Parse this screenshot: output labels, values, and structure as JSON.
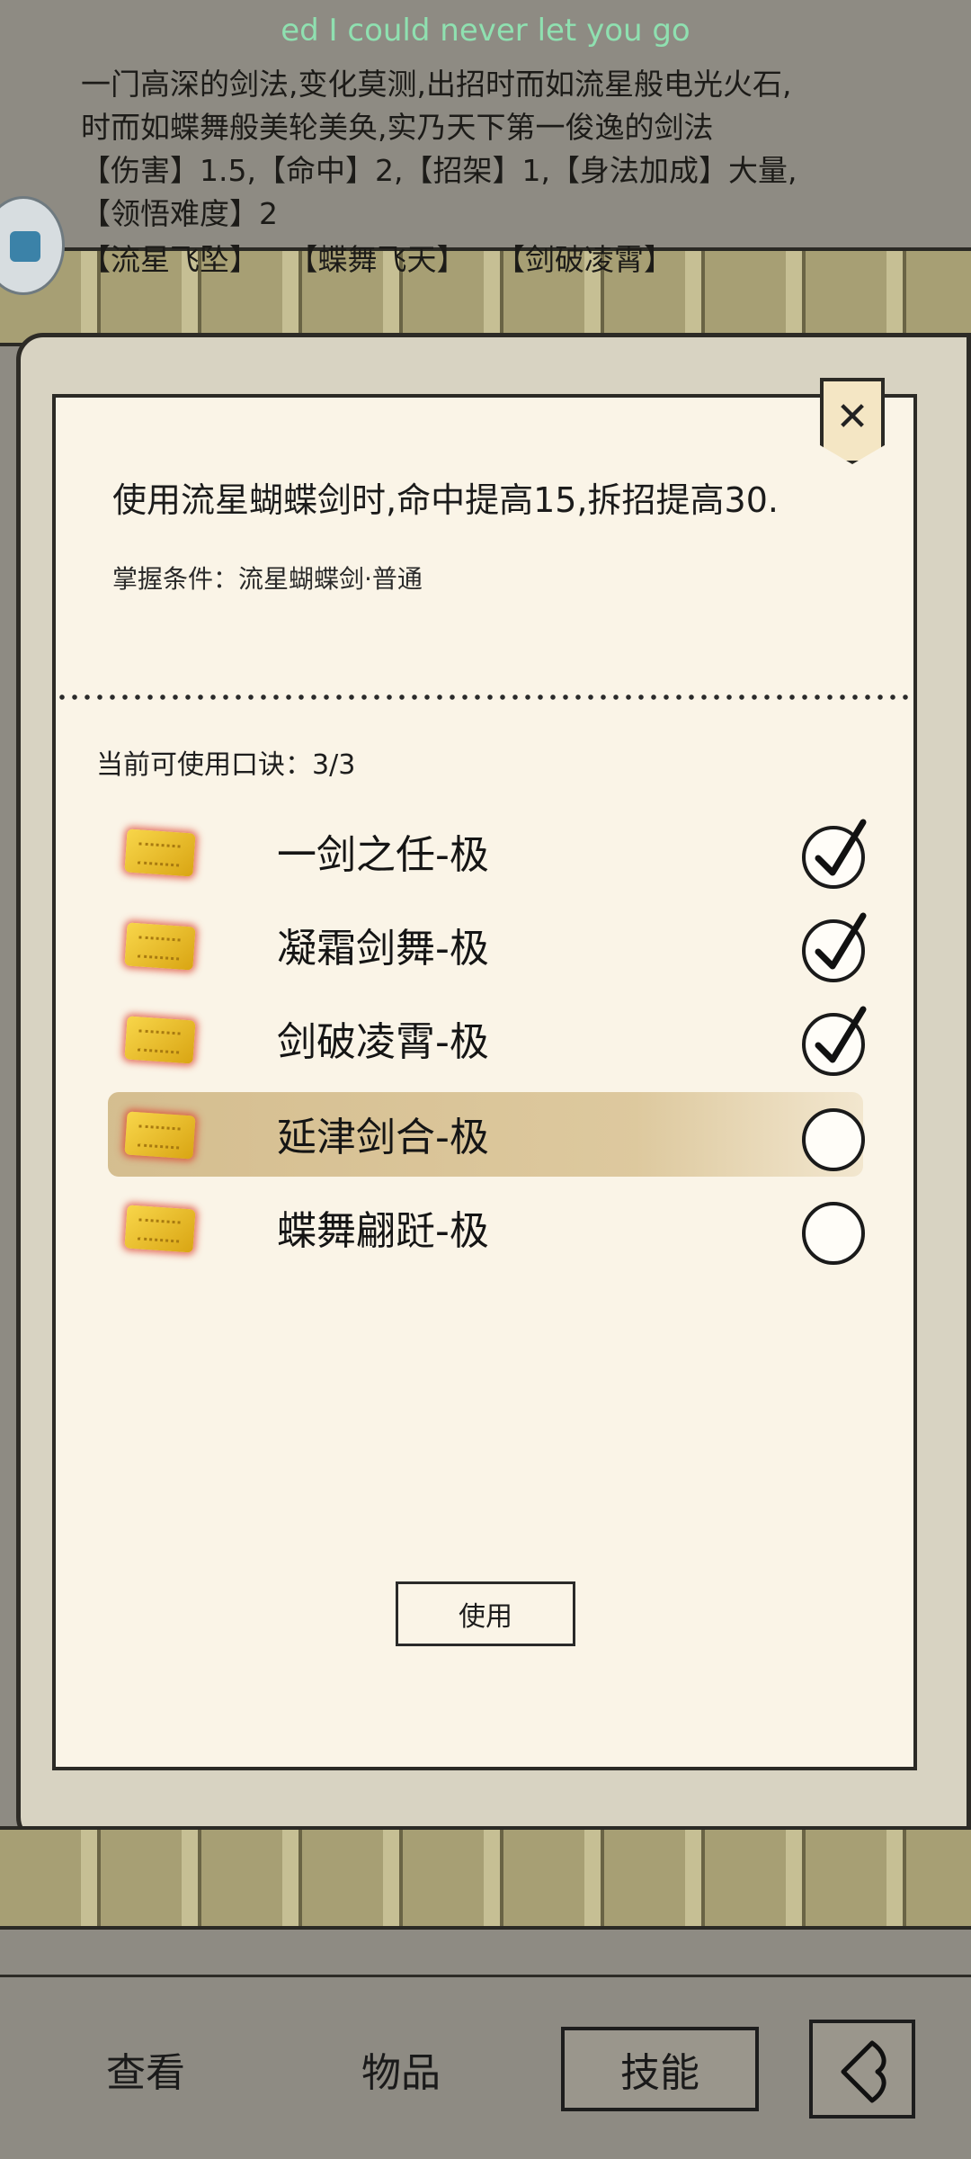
{
  "lyric": "ed I could never let you go",
  "skill_description": {
    "lines": [
      "一门高深的剑法,变化莫测,出招时而如流星般电光火石,",
      "时而如蝶舞般美轮美奂,实乃天下第一俊逸的剑法",
      "【伤害】1.5,【命中】2,【招架】1,【身法加成】大量,",
      "【领悟难度】2"
    ],
    "moves": [
      "【流星飞坠】",
      "【蝶舞飞天】",
      "【剑破凌霄】"
    ]
  },
  "dialog": {
    "effect_text": "使用流星蝴蝶剑时,命中提高15,拆招提高30.",
    "condition_text": "掌握条件：流星蝴蝶剑·普通",
    "count_text": "当前可使用口诀：3/3",
    "close_label": "✕",
    "use_label": "使用",
    "secrets": [
      {
        "name": "一剑之任-极",
        "checked": true,
        "selected": false
      },
      {
        "name": "凝霜剑舞-极",
        "checked": true,
        "selected": false
      },
      {
        "name": "剑破凌霄-极",
        "checked": true,
        "selected": false
      },
      {
        "name": "延津剑合-极",
        "checked": false,
        "selected": true
      },
      {
        "name": "蝶舞翩跹-极",
        "checked": false,
        "selected": false
      }
    ]
  },
  "nav": {
    "view": "查看",
    "items": "物品",
    "skills": "技能",
    "back_icon": "back-arrow-icon"
  }
}
